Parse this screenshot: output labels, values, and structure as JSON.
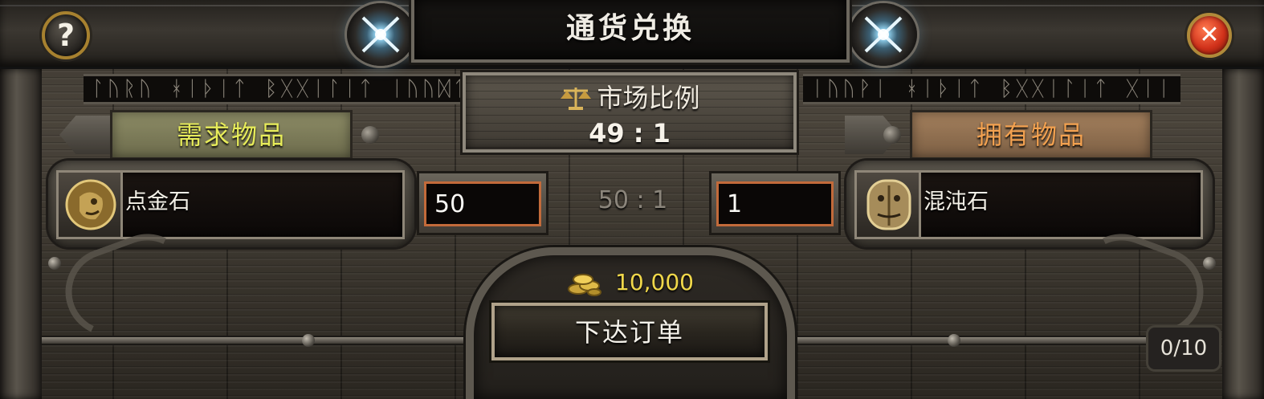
{
  "window": {
    "title": "通货兑换",
    "help_label": "?",
    "close_label": "✕"
  },
  "market": {
    "label": "市场比例",
    "ratio": "49 : 1",
    "icon": "scale-icon"
  },
  "want": {
    "tag": "需求物品",
    "item_name": "点金石",
    "quantity": "50",
    "icon": "orb-of-alchemy-icon"
  },
  "have": {
    "tag": "拥有物品",
    "item_name": "混沌石",
    "quantity": "1",
    "icon": "chaos-orb-icon"
  },
  "current_ratio": "50 : 1",
  "cost": {
    "value": "10,000",
    "icon": "gold-coins-icon"
  },
  "order_button_label": "下达订单",
  "order_count": "0/10",
  "runes": {
    "left": "ᛚᚢᚱᚢ ᚼᛁᚦᛁᛏ ᛒᚷᚷᛁᛚᛁᛏ ᛁᚢᚢᛞᛏ",
    "right": "ᛁᚢᚢᚹᛁ ᚼᛁᚦᛁᛏ ᛒᚷᚷᛁᛚᛁᛏ ᚷᛁᛁ"
  },
  "colors": {
    "want_tag_text": "#e7ec5a",
    "have_tag_text": "#f2a150",
    "cost_text": "#f0d84a",
    "qty_border": "#c26a3a"
  }
}
